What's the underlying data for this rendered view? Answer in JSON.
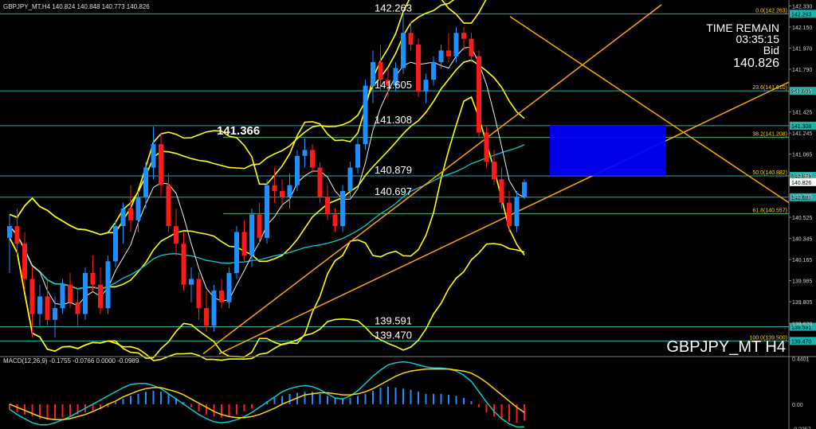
{
  "header": {
    "symbol_info": "GBPJPY_MT,H4 140.824 140.848 140.773 140.826",
    "macd_info": "MACD(12,26,9) -0.1755 -0.0766 0.0000 -0.0989"
  },
  "overlay": {
    "time_remain_label": "TIME REMAIN",
    "time_remain_value": "03:35:15",
    "bid_label": "Bid",
    "bid_value": "140.826",
    "watermark": "GBPJPY_MT H4"
  },
  "colors": {
    "background": "#000000",
    "bull_candle": "#1E90FF",
    "bear_candle": "#FF1A1A",
    "level_line": "#20B2AA",
    "bollinger": "#FFFF00",
    "trendline": "#FFA500",
    "ma_cyan": "#00CED1",
    "ma_white": "#F0F0F0",
    "zone": "#0000FF",
    "macd_signal": "#FFD700"
  },
  "chart_data": {
    "type": "candlestick",
    "price_range": [
      139.35,
      142.34
    ],
    "y_axis_ticks": [
      "142.330",
      "142.150",
      "141.970",
      "141.790",
      "141.605",
      "141.425",
      "141.245",
      "141.065",
      "140.885",
      "140.705",
      "140.525",
      "140.345",
      "140.165",
      "139.985",
      "139.805",
      "139.620"
    ],
    "levels": [
      {
        "price": 142.263,
        "label": "142.263",
        "axis_label": "142.263",
        "fib_label": "0.0(142.263)"
      },
      {
        "price": 141.605,
        "label": "141.605",
        "axis_label": "141.605",
        "fib_label": "23.6(141.610)"
      },
      {
        "price": 141.308,
        "label": "141.308",
        "axis_label": "141.308",
        "fib_label": ""
      },
      {
        "price": 141.208,
        "label": "",
        "axis_label": "",
        "fib_label": "38.2(141.208)"
      },
      {
        "price": 140.879,
        "label": "140.879",
        "axis_label": "140.879",
        "fib_label": "50.0(140.882)"
      },
      {
        "price": 140.697,
        "label": "140.697",
        "axis_label": "140.697",
        "fib_label": ""
      },
      {
        "price": 140.557,
        "label": "",
        "axis_label": "",
        "fib_label": "61.8(140.557)"
      },
      {
        "price": 139.591,
        "label": "139.591",
        "axis_label": "139.591",
        "fib_label": ""
      },
      {
        "price": 139.47,
        "label": "139.470",
        "axis_label": "139.470",
        "fib_label": "100.0(139.500)"
      }
    ],
    "highlight_label": "141.366",
    "current_price": "140.826",
    "candles": [
      {
        "o": 140.35,
        "h": 140.55,
        "l": 140.05,
        "c": 140.45
      },
      {
        "o": 140.45,
        "h": 140.6,
        "l": 140.2,
        "c": 140.3
      },
      {
        "o": 140.3,
        "h": 140.4,
        "l": 139.9,
        "c": 140.0
      },
      {
        "o": 140.0,
        "h": 140.1,
        "l": 139.5,
        "c": 139.7
      },
      {
        "o": 139.7,
        "h": 139.95,
        "l": 139.6,
        "c": 139.85
      },
      {
        "o": 139.85,
        "h": 140.0,
        "l": 139.6,
        "c": 139.65
      },
      {
        "o": 139.65,
        "h": 139.85,
        "l": 139.5,
        "c": 139.75
      },
      {
        "o": 139.75,
        "h": 140.0,
        "l": 139.7,
        "c": 139.95
      },
      {
        "o": 139.95,
        "h": 140.05,
        "l": 139.75,
        "c": 139.8
      },
      {
        "o": 139.8,
        "h": 139.9,
        "l": 139.6,
        "c": 139.7
      },
      {
        "o": 139.7,
        "h": 140.1,
        "l": 139.65,
        "c": 140.05
      },
      {
        "o": 140.05,
        "h": 140.2,
        "l": 139.9,
        "c": 139.95
      },
      {
        "o": 139.95,
        "h": 140.1,
        "l": 139.7,
        "c": 139.75
      },
      {
        "o": 139.75,
        "h": 140.2,
        "l": 139.7,
        "c": 140.15
      },
      {
        "o": 140.15,
        "h": 140.5,
        "l": 140.1,
        "c": 140.45
      },
      {
        "o": 140.45,
        "h": 140.65,
        "l": 140.3,
        "c": 140.6
      },
      {
        "o": 140.6,
        "h": 140.8,
        "l": 140.4,
        "c": 140.5
      },
      {
        "o": 140.5,
        "h": 140.75,
        "l": 140.4,
        "c": 140.7
      },
      {
        "o": 140.7,
        "h": 141.0,
        "l": 140.6,
        "c": 140.95
      },
      {
        "o": 140.95,
        "h": 141.3,
        "l": 140.85,
        "c": 141.15
      },
      {
        "o": 141.15,
        "h": 141.25,
        "l": 140.7,
        "c": 140.8
      },
      {
        "o": 140.8,
        "h": 140.9,
        "l": 140.4,
        "c": 140.45
      },
      {
        "o": 140.45,
        "h": 140.6,
        "l": 140.2,
        "c": 140.3
      },
      {
        "o": 140.3,
        "h": 140.4,
        "l": 139.9,
        "c": 139.95
      },
      {
        "o": 139.95,
        "h": 140.1,
        "l": 139.8,
        "c": 140.0
      },
      {
        "o": 140.0,
        "h": 140.05,
        "l": 139.65,
        "c": 139.75
      },
      {
        "o": 139.75,
        "h": 139.9,
        "l": 139.55,
        "c": 139.6
      },
      {
        "o": 139.6,
        "h": 139.95,
        "l": 139.55,
        "c": 139.9
      },
      {
        "o": 139.9,
        "h": 140.0,
        "l": 139.75,
        "c": 139.8
      },
      {
        "o": 139.8,
        "h": 140.1,
        "l": 139.75,
        "c": 140.05
      },
      {
        "o": 140.05,
        "h": 140.45,
        "l": 140.0,
        "c": 140.4
      },
      {
        "o": 140.4,
        "h": 140.5,
        "l": 140.15,
        "c": 140.2
      },
      {
        "o": 140.2,
        "h": 140.6,
        "l": 140.1,
        "c": 140.55
      },
      {
        "o": 140.55,
        "h": 140.65,
        "l": 140.3,
        "c": 140.35
      },
      {
        "o": 140.35,
        "h": 140.85,
        "l": 140.3,
        "c": 140.8
      },
      {
        "o": 140.8,
        "h": 140.95,
        "l": 140.65,
        "c": 140.75
      },
      {
        "o": 140.75,
        "h": 140.85,
        "l": 140.6,
        "c": 140.7
      },
      {
        "o": 140.7,
        "h": 140.9,
        "l": 140.6,
        "c": 140.8
      },
      {
        "o": 140.8,
        "h": 141.1,
        "l": 140.75,
        "c": 141.05
      },
      {
        "o": 141.05,
        "h": 141.2,
        "l": 140.95,
        "c": 141.1
      },
      {
        "o": 141.1,
        "h": 141.15,
        "l": 140.9,
        "c": 140.95
      },
      {
        "o": 140.95,
        "h": 141.0,
        "l": 140.65,
        "c": 140.7
      },
      {
        "o": 140.7,
        "h": 140.8,
        "l": 140.5,
        "c": 140.55
      },
      {
        "o": 140.55,
        "h": 140.6,
        "l": 140.4,
        "c": 140.45
      },
      {
        "o": 140.45,
        "h": 140.8,
        "l": 140.4,
        "c": 140.75
      },
      {
        "o": 140.75,
        "h": 141.0,
        "l": 140.7,
        "c": 140.95
      },
      {
        "o": 140.95,
        "h": 141.2,
        "l": 140.9,
        "c": 141.15
      },
      {
        "o": 141.15,
        "h": 141.7,
        "l": 141.1,
        "c": 141.65
      },
      {
        "o": 141.65,
        "h": 141.95,
        "l": 141.5,
        "c": 141.85
      },
      {
        "o": 141.85,
        "h": 142.0,
        "l": 141.6,
        "c": 141.7
      },
      {
        "o": 141.7,
        "h": 141.8,
        "l": 141.55,
        "c": 141.65
      },
      {
        "o": 141.65,
        "h": 141.85,
        "l": 141.6,
        "c": 141.8
      },
      {
        "o": 141.8,
        "h": 142.26,
        "l": 141.75,
        "c": 142.1
      },
      {
        "o": 142.1,
        "h": 142.2,
        "l": 141.95,
        "c": 142.0
      },
      {
        "o": 142.0,
        "h": 142.05,
        "l": 141.55,
        "c": 141.6
      },
      {
        "o": 141.6,
        "h": 141.75,
        "l": 141.5,
        "c": 141.7
      },
      {
        "o": 141.7,
        "h": 141.9,
        "l": 141.65,
        "c": 141.85
      },
      {
        "o": 141.85,
        "h": 142.0,
        "l": 141.8,
        "c": 141.95
      },
      {
        "o": 141.95,
        "h": 142.1,
        "l": 141.85,
        "c": 141.9
      },
      {
        "o": 141.9,
        "h": 142.15,
        "l": 141.85,
        "c": 142.1
      },
      {
        "o": 142.1,
        "h": 142.15,
        "l": 141.95,
        "c": 142.05
      },
      {
        "o": 142.05,
        "h": 142.1,
        "l": 141.85,
        "c": 141.9
      },
      {
        "o": 141.9,
        "h": 141.95,
        "l": 141.2,
        "c": 141.25
      },
      {
        "o": 141.25,
        "h": 141.3,
        "l": 140.95,
        "c": 141.0
      },
      {
        "o": 141.0,
        "h": 141.1,
        "l": 140.8,
        "c": 140.85
      },
      {
        "o": 140.85,
        "h": 140.95,
        "l": 140.6,
        "c": 140.65
      },
      {
        "o": 140.65,
        "h": 140.75,
        "l": 140.4,
        "c": 140.45
      },
      {
        "o": 140.45,
        "h": 140.75,
        "l": 140.4,
        "c": 140.7
      },
      {
        "o": 140.7,
        "h": 140.85,
        "l": 140.68,
        "c": 140.826
      }
    ],
    "macd": {
      "range": [
        -0.24,
        0.46
      ],
      "axis_ticks": [
        "0.4401",
        "0.00",
        "-0.2357"
      ],
      "histogram": [
        -0.05,
        -0.08,
        -0.1,
        -0.12,
        -0.14,
        -0.15,
        -0.15,
        -0.13,
        -0.12,
        -0.1,
        -0.08,
        -0.06,
        -0.05,
        -0.03,
        0.02,
        0.05,
        0.08,
        0.1,
        0.12,
        0.13,
        0.12,
        0.1,
        0.06,
        0.02,
        -0.03,
        -0.07,
        -0.1,
        -0.12,
        -0.13,
        -0.12,
        -0.1,
        -0.07,
        -0.04,
        0.0,
        0.03,
        0.06,
        0.08,
        0.1,
        0.11,
        0.12,
        0.12,
        0.1,
        0.08,
        0.06,
        0.05,
        0.06,
        0.08,
        0.1,
        0.13,
        0.16,
        0.17,
        0.16,
        0.15,
        0.14,
        0.12,
        0.1,
        0.1,
        0.1,
        0.09,
        0.08,
        0.06,
        0.03,
        -0.03,
        -0.08,
        -0.12,
        -0.15,
        -0.17,
        -0.18,
        -0.16
      ],
      "macd_line": [
        -0.05,
        -0.1,
        -0.14,
        -0.18,
        -0.2,
        -0.2,
        -0.18,
        -0.15,
        -0.12,
        -0.08,
        -0.04,
        0.0,
        0.04,
        0.08,
        0.12,
        0.16,
        0.19,
        0.2,
        0.2,
        0.18,
        0.15,
        0.1,
        0.05,
        0.0,
        -0.05,
        -0.1,
        -0.14,
        -0.17,
        -0.18,
        -0.17,
        -0.15,
        -0.12,
        -0.08,
        -0.03,
        0.02,
        0.07,
        0.12,
        0.15,
        0.17,
        0.18,
        0.17,
        0.14,
        0.1,
        0.06,
        0.05,
        0.08,
        0.13,
        0.2,
        0.27,
        0.33,
        0.38,
        0.4,
        0.41,
        0.4,
        0.38,
        0.36,
        0.35,
        0.35,
        0.34,
        0.32,
        0.28,
        0.22,
        0.12,
        0.02,
        -0.07,
        -0.14,
        -0.19,
        -0.22,
        -0.22
      ],
      "signal_line": [
        0.0,
        -0.03,
        -0.06,
        -0.09,
        -0.12,
        -0.14,
        -0.15,
        -0.15,
        -0.14,
        -0.12,
        -0.1,
        -0.07,
        -0.04,
        0.0,
        0.03,
        0.07,
        0.1,
        0.13,
        0.15,
        0.16,
        0.16,
        0.14,
        0.12,
        0.09,
        0.05,
        0.01,
        -0.03,
        -0.07,
        -0.1,
        -0.12,
        -0.13,
        -0.13,
        -0.12,
        -0.1,
        -0.07,
        -0.04,
        0.0,
        0.03,
        0.06,
        0.09,
        0.1,
        0.11,
        0.11,
        0.1,
        0.09,
        0.09,
        0.1,
        0.12,
        0.15,
        0.19,
        0.23,
        0.27,
        0.3,
        0.32,
        0.33,
        0.34,
        0.34,
        0.34,
        0.34,
        0.33,
        0.32,
        0.3,
        0.26,
        0.21,
        0.15,
        0.09,
        0.03,
        -0.03,
        -0.08
      ]
    }
  }
}
